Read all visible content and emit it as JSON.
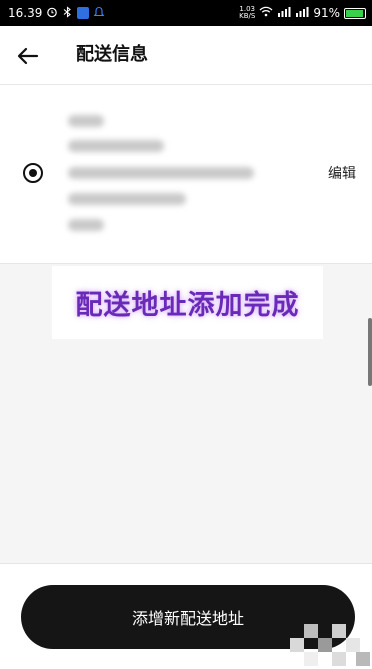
{
  "status_bar": {
    "time": "16.39",
    "speed_top": "1.03",
    "speed_bottom": "KB/S",
    "battery": "91%"
  },
  "header": {
    "title": "配送信息"
  },
  "address": {
    "edit_label": "编辑",
    "selected": true
  },
  "overlay": {
    "text": "配送地址添加完成"
  },
  "bottom": {
    "add_button_label": "添增新配送地址"
  },
  "colors": {
    "button_bg": "#151515",
    "overlay_text": "#6a2ab8",
    "battery_fill": "#3ad04a"
  },
  "icons": [
    "alarm-icon",
    "bluetooth-icon",
    "app-notification-icon",
    "wifi-icon",
    "signal-icon",
    "battery-icon",
    "back-arrow-icon",
    "radio-selected-icon"
  ]
}
